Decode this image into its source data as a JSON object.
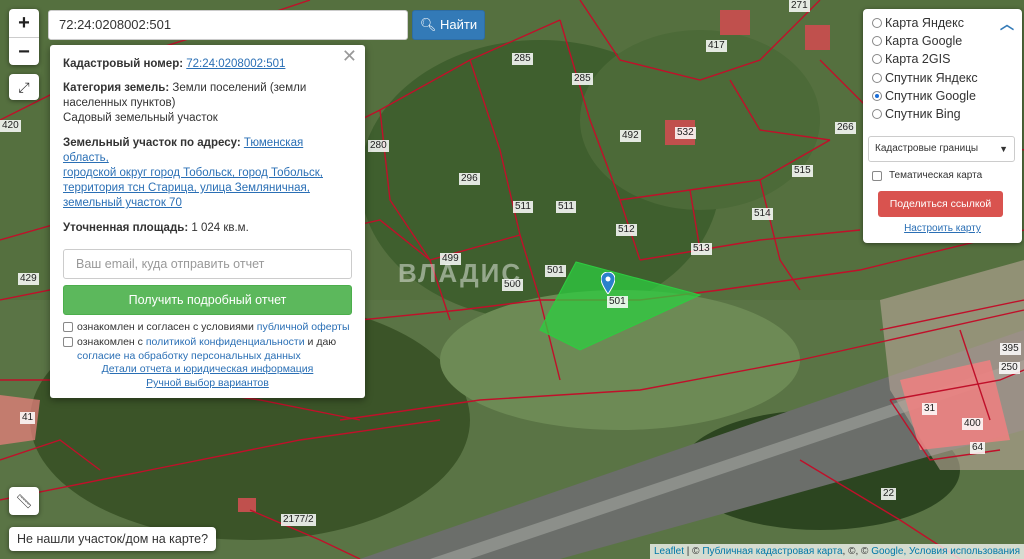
{
  "search": {
    "query": "72:24:0208002:501",
    "button_label": "Найти"
  },
  "zoom": {
    "in": "+",
    "out": "−"
  },
  "info_panel": {
    "cadastral_label": "Кадастровый номер:",
    "cadastral_value": "72:24:0208002:501",
    "category_label": "Категория земель:",
    "category_value_1": "Земли поселений (земли",
    "category_value_2": "населенных пунктов)",
    "usage": "Садовый земельный участок",
    "address_label": "Земельный участок по адресу:",
    "address_1": "Тюменская область,",
    "address_2": "городской округ город Тобольск, город Тобольск,",
    "address_3": "территория тсн Старица, улица Земляничная,",
    "address_4": "земельный участок 70",
    "area_label": "Уточненная площадь:",
    "area_value": "1 024 кв.м.",
    "email_placeholder": "Ваш email, куда отправить отчет",
    "report_button": "Получить подробный отчет",
    "consent1_text": "ознакомлен и согласен с условиями",
    "consent1_link": "публичной оферты",
    "consent2_text": "ознакомлен с",
    "consent2_link": "политикой конфиденциальности",
    "consent2_tail": "и даю",
    "consent2_line2": "согласие на обработку персональных данных",
    "details_link": "Детали отчета и юридическая информация",
    "manual_link": "Ручной выбор вариантов"
  },
  "layers": {
    "options": [
      {
        "label": "Карта Яндекс",
        "selected": false
      },
      {
        "label": "Карта Google",
        "selected": false
      },
      {
        "label": "Карта 2GIS",
        "selected": false
      },
      {
        "label": "Спутник Яндекс",
        "selected": false
      },
      {
        "label": "Спутник Google",
        "selected": true
      },
      {
        "label": "Спутник Bing",
        "selected": false
      }
    ],
    "overlay_select": "Кадастровые границы",
    "thematic_label": "Тематическая карта",
    "share_button": "Поделиться ссылкой",
    "setup_link": "Настроить карту"
  },
  "not_found": "Не нашли участок/дом на карте?",
  "attribution": {
    "leaflet": "Leaflet",
    "sep": "|",
    "copy": "©",
    "pkk": "Публичная кадастровая карта",
    "copy2": ", ©, ©",
    "google": "Google",
    "terms": ", Условия использования"
  },
  "watermark": "ВЛАДИС",
  "parcel_labels": [
    "285",
    "285",
    "271",
    "417",
    "492",
    "532",
    "266",
    "296",
    "511",
    "511",
    "515",
    "514",
    "512",
    "513",
    "499",
    "500",
    "501",
    "501",
    "280",
    "429",
    "395",
    "250",
    "31",
    "400",
    "64",
    "22",
    "2177/2",
    "420",
    "41"
  ],
  "colors": {
    "boundary": "#c0102a",
    "selected_parcel": "#2ecc40",
    "accent": "#337ab7",
    "report": "#5cb85c",
    "share": "#d9534f"
  }
}
